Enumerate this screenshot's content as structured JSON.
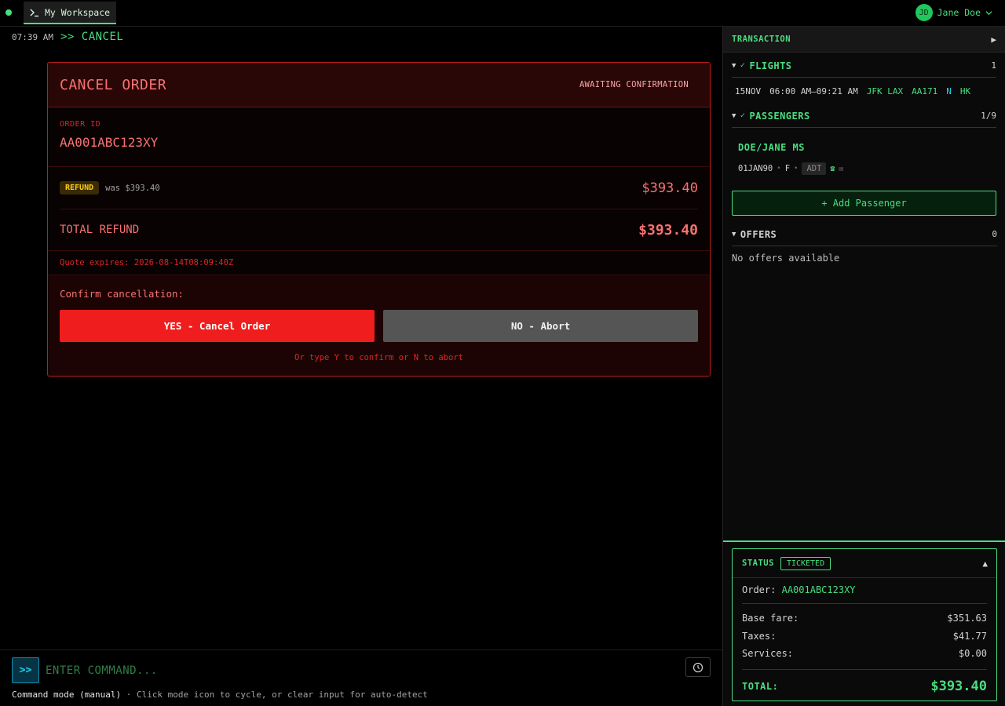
{
  "header": {
    "workspace_tab": "My Workspace",
    "user_initials": "JD",
    "user_name": "Jane Doe"
  },
  "command_log": {
    "time": "07:39 AM",
    "command": ">> CANCEL"
  },
  "cancel_card": {
    "title": "CANCEL ORDER",
    "status": "AWAITING CONFIRMATION",
    "order_id_label": "ORDER ID",
    "order_id": "AA001ABC123XY",
    "refund_badge": "REFUND",
    "refund_was": "was $393.40",
    "refund_amount": "$393.40",
    "total_label": "TOTAL REFUND",
    "total_amount": "$393.40",
    "quote_expiry": "Quote expires: 2026-08-14T08:09:40Z",
    "confirm_label": "Confirm cancellation:",
    "yes_label": "YES - Cancel Order",
    "no_label": "NO - Abort",
    "hint": "Or type Y to confirm or N to abort"
  },
  "command_bar": {
    "prompt_label": ">>",
    "placeholder": "ENTER COMMAND...",
    "mode_strong": "Command mode (manual)",
    "mode_hint": " · Click mode icon to cycle, or clear input for auto-detect"
  },
  "sidebar": {
    "title": "TRANSACTION",
    "toggle": "▶",
    "flights": {
      "name": "FLIGHTS",
      "count": "1",
      "rows": [
        {
          "date": "15NOV",
          "time": "06:00 AM–09:21 AM",
          "route": "JFK LAX",
          "flight": "AA171",
          "class": "N",
          "status": "HK"
        }
      ]
    },
    "passengers": {
      "name": "PASSENGERS",
      "count": "1/9",
      "items": [
        {
          "name": "DOE/JANE MS",
          "dob": "01JAN90",
          "gender": "F",
          "type": "ADT"
        }
      ],
      "add_label": "+ Add Passenger"
    },
    "offers": {
      "name": "OFFERS",
      "count": "0",
      "empty": "No offers available"
    },
    "status": {
      "label": "STATUS",
      "badge": "TICKETED",
      "collapse": "▲",
      "order_label": "Order:",
      "order_value": "AA001ABC123XY",
      "fares": [
        {
          "label": "Base fare:",
          "value": "$351.63"
        },
        {
          "label": "Taxes:",
          "value": "$41.77"
        },
        {
          "label": "Services:",
          "value": "$0.00"
        }
      ],
      "total_label": "TOTAL:",
      "total_value": "$393.40"
    }
  },
  "colors": {
    "accent_green": "#4ade80",
    "danger_red": "#ef1d1d",
    "cyan": "#22d3ee"
  }
}
